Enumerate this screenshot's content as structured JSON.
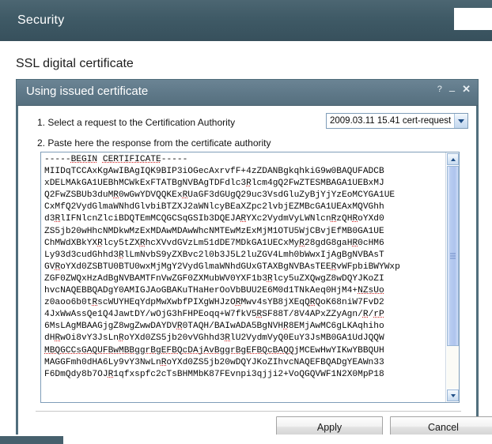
{
  "appbar": {
    "title": "Security"
  },
  "page": {
    "title": "SSL digital certificate"
  },
  "dialog": {
    "title": "Using issued certificate",
    "titlebar_buttons": {
      "help": "?",
      "minimize": "–",
      "close": "✕"
    },
    "step1_label": "1. Select a request to the Certification Authority",
    "step2_label": "2. Paste here the response from the certificate authority",
    "request_select": {
      "value": "2009.03.11 15.41 cert-request",
      "options": [
        "2009.03.11 15.41 cert-request"
      ]
    },
    "certificate_text": "-----BEGIN CERTIFICATE-----\nMIIDqTCCAxKgAwIBAgIQK9BIP3iOGecAxrvfF+4zZDANBgkqhkiG9w0BAQUFADCB\nxDELMAkGA1UEBhMCWkExFTATBgNVBAgTDFdlc3Rlcm4gQ2FwZTESMBAGA1UEBxMJ\nQ2FwZSBUb3duMR0wGwYDVQQKExRUaGF3dGUgQ29uc3VsdGluZyBjYjYzEoMCYGA1UE\nCxMfQ2VydGlmaWNhdGlvbiBTZXJ2aWNlcyBEaXZpc2lvbjEZMBcGA1UEAxMQVGhh\nd3RlIFNlcnZlciBDQTEmMCQGCSqGSIb3DQEJARYXc2VydmVyLWNlcnRzQHRoYXd0\nZS5jb20wHhcNMDkwMzExMDAwMDAwWhcNMTEwMzExMjM1OTU5WjCBvjEfMB0GA1UE\nChMWdXBkYXRlcy5tZXRhcXVvdGVzLm51dDE7MDkGA1UECxMyR28gdG8gaHR0cHM6\nLy93d3cudGhhd3RlLmNvbS9yZXBvc2l0b3J5L2luZGV4Lmh0bWwxIjAgBgNVBAsT\nGVRoYXd0ZSBTU0BTU0wxMjMgY2VydGlmaWNhdGUxGTAXBgNVBAsTEERvWFpbiBWYWxp\nZGF0ZWQxHzAdBgNVBAMTFnVwZGF0ZXMubWV0YXF1b3Rlcy5uZXQwgZ8wDQYJKoZI\nhvcNAQEBBQADgY0AMIGJAoGBAKuTHaHerOoVbBUU2E6M0d1TNkAeq0HjM4+NZsUo\nz0aoo6b0tRscWUYHEqYdpMwXwbfPIXgWHJzORMwv4sYB8jXEqQRQoK68niW7FvD2\n4JxWwAssQe1Q4JawtDY/wOjG3hFHPEoqq+W7fkV5RSF88T/8V4APxZZyAgn/R/rP\n6MsLAgMBAAGjgZ8wgZwwDAYDVR0TAQH/BAIwADA5BgNVHR8EMjAwMC6gLKAqhiho\ndHRwOi8vY3JsLnRoYXd0ZS5jb20vVGhhd3RlU2VydmVyQ0EuY3JsMB0GA1UdJQQW\nMBQGCCsGAQUFBwMBBggrBgEFBQcDAjAvBggrBgEFBQcBAQQjMCEwHwYIKwYBBQUH\nMAGGFmh0dHA6Ly9vY3NwLnRoYXd0ZS5jb20wDQYJKoZIhvcNAQEFBQADgYEAWn33\nF6DmQdy8b7OJR1qfxspfc2cTsBHMMbK87FEvnpi3qjji2+VoQGQVWF1N2X0MpP18",
    "spellchecked_phrases": [
      "BEGIN",
      "CERTIFICATE",
      "NZsUo",
      "R",
      "rP",
      "MBQGCCsGAQUFBwMBBggrBgEFBQcDAjAvBggrBgEFBQcBAQQ"
    ],
    "apply_label": "Apply",
    "cancel_label": "Cancel"
  },
  "colors": {
    "appbar": "#3f5a66",
    "dialog_titlebar": "#5e7888",
    "dialog_border": "#4e6b79",
    "scrollbar_thumb": "#aec4ee",
    "accent": "#46606d"
  }
}
